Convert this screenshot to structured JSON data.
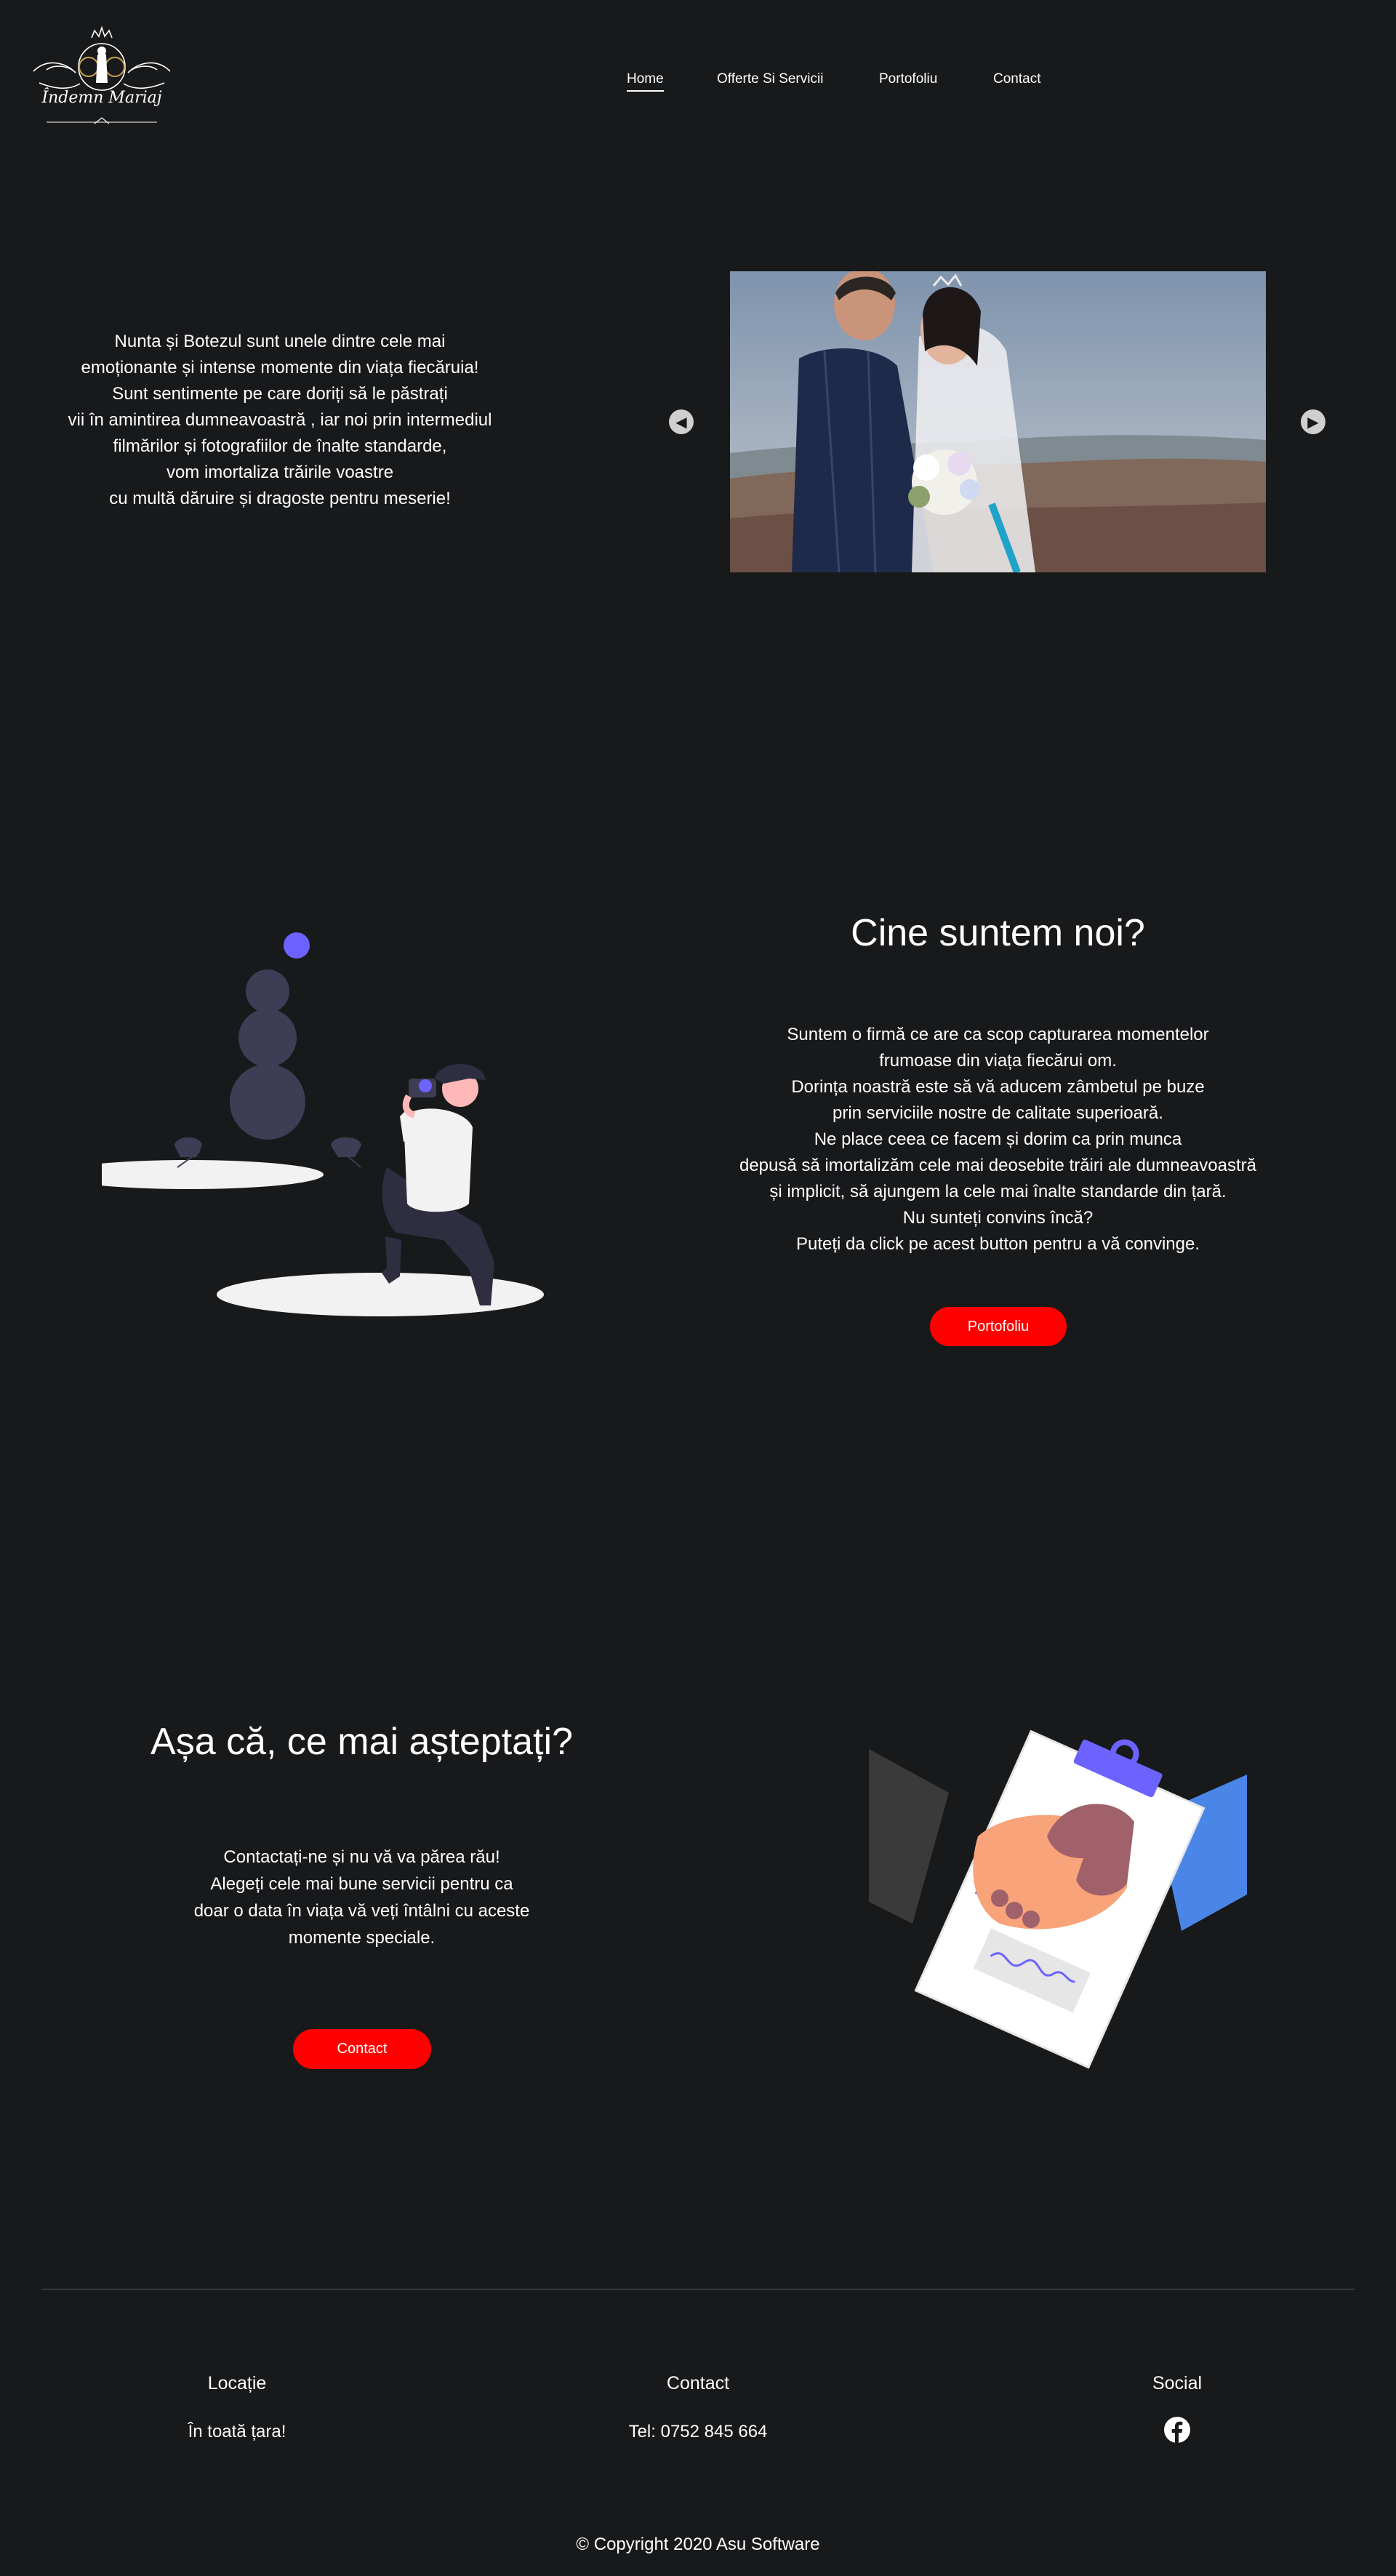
{
  "header": {
    "logo": {
      "text": "Îndemn Mariaj"
    },
    "nav": [
      {
        "label": "Home",
        "active": true
      },
      {
        "label": "Offerte Si Servicii",
        "active": false
      },
      {
        "label": "Portofoliu",
        "active": false
      },
      {
        "label": "Contact",
        "active": false
      }
    ]
  },
  "hero": {
    "lines": [
      "Nunta și Botezul sunt unele dintre cele mai",
      "emoționante și intense momente din viața fiecăruia!",
      "Sunt sentimente pe care doriți să le păstrați",
      "vii în amintirea dumneavoastră , iar noi prin intermediul",
      "filmărilor și fotografiilor de înalte  standarde,",
      "vom imortaliza trăirile voastre",
      "cu multă dăruire și dragoste pentru meserie!"
    ],
    "slider": {
      "prev_icon": "arrow-left-icon",
      "next_icon": "arrow-right-icon"
    }
  },
  "about": {
    "title": "Cine suntem noi?",
    "lines": [
      "Suntem o firmă ce are ca scop capturarea momentelor",
      "frumoase din viața fiecărui om.",
      "Dorința noastră este să vă aducem zâmbetul pe buze",
      "prin serviciile nostre de calitate superioară.",
      "Ne place ceea ce facem și  dorim ca prin munca",
      "depusă să imortalizăm cele mai deosebite trăiri ale dumneavoastră",
      "și implicit, să ajungem la cele mai înalte standarde din țară.",
      "Nu sunteți convins încă?",
      "Puteți da click pe acest button pentru a vă convinge."
    ],
    "button": "Portofoliu"
  },
  "cta": {
    "title": "Așa că, ce mai așteptați?",
    "lines": [
      "Contactați-ne și nu vă va părea rău!",
      "Alegeți cele mai bune servicii pentru ca",
      "doar o data în viața vă veți întâlni cu aceste",
      "momente speciale."
    ],
    "button": "Contact"
  },
  "footer": {
    "location": {
      "heading": "Locație",
      "value": "În toată țara!"
    },
    "contact": {
      "heading": "Contact",
      "value": "Tel: 0752 845 664"
    },
    "social": {
      "heading": "Social",
      "icon": "facebook-icon"
    },
    "copyright": "© Copyright 2020 Asu Software"
  },
  "colors": {
    "background": "#18191b",
    "accent_red": "#ff0000",
    "illustration_purple": "#6c63ff"
  }
}
